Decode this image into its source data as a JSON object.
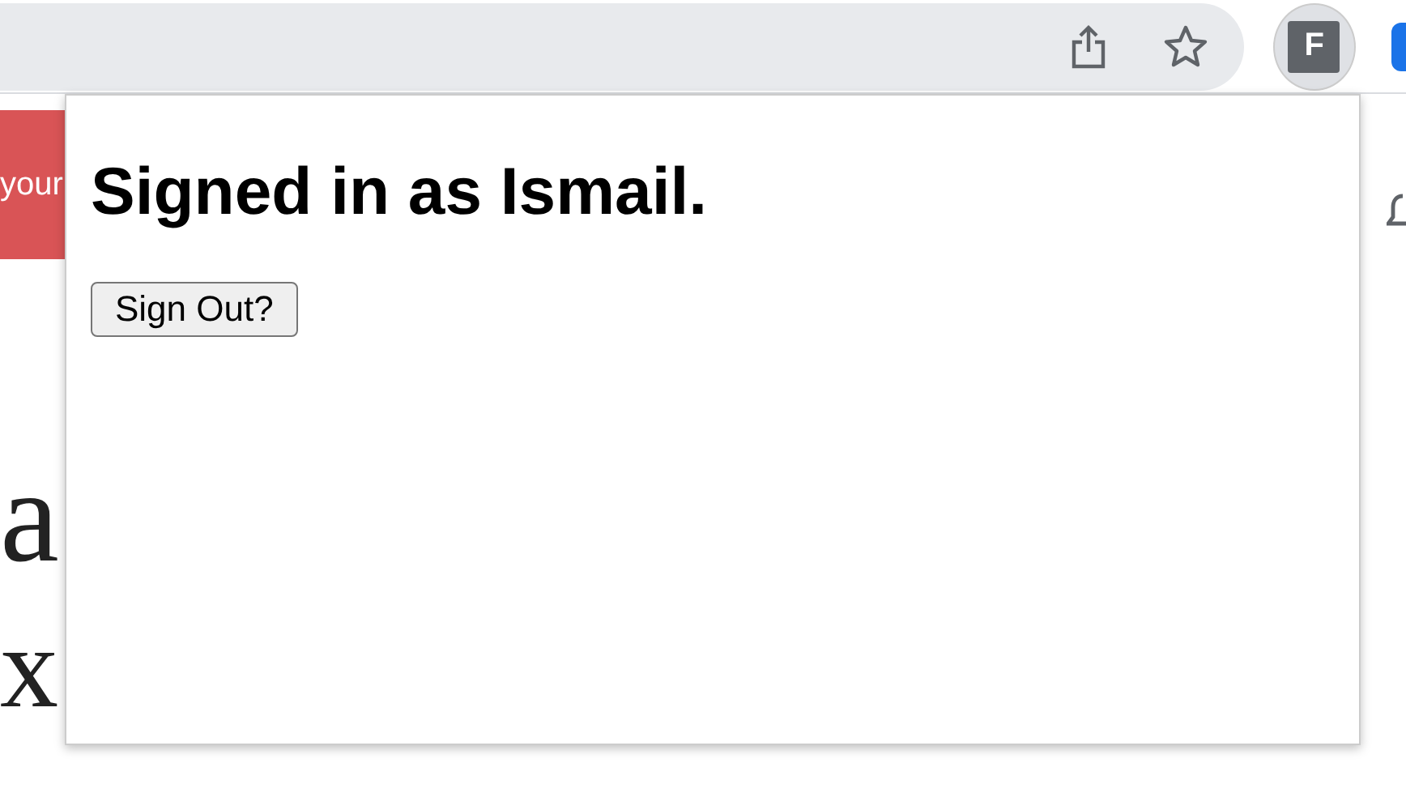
{
  "toolbar": {
    "profile_initial": "F"
  },
  "page": {
    "banner_text": "your",
    "heading_fragment": "a",
    "line_fragment": "x"
  },
  "popup": {
    "heading": "Signed in as Ismail.",
    "button": "Sign Out?"
  }
}
